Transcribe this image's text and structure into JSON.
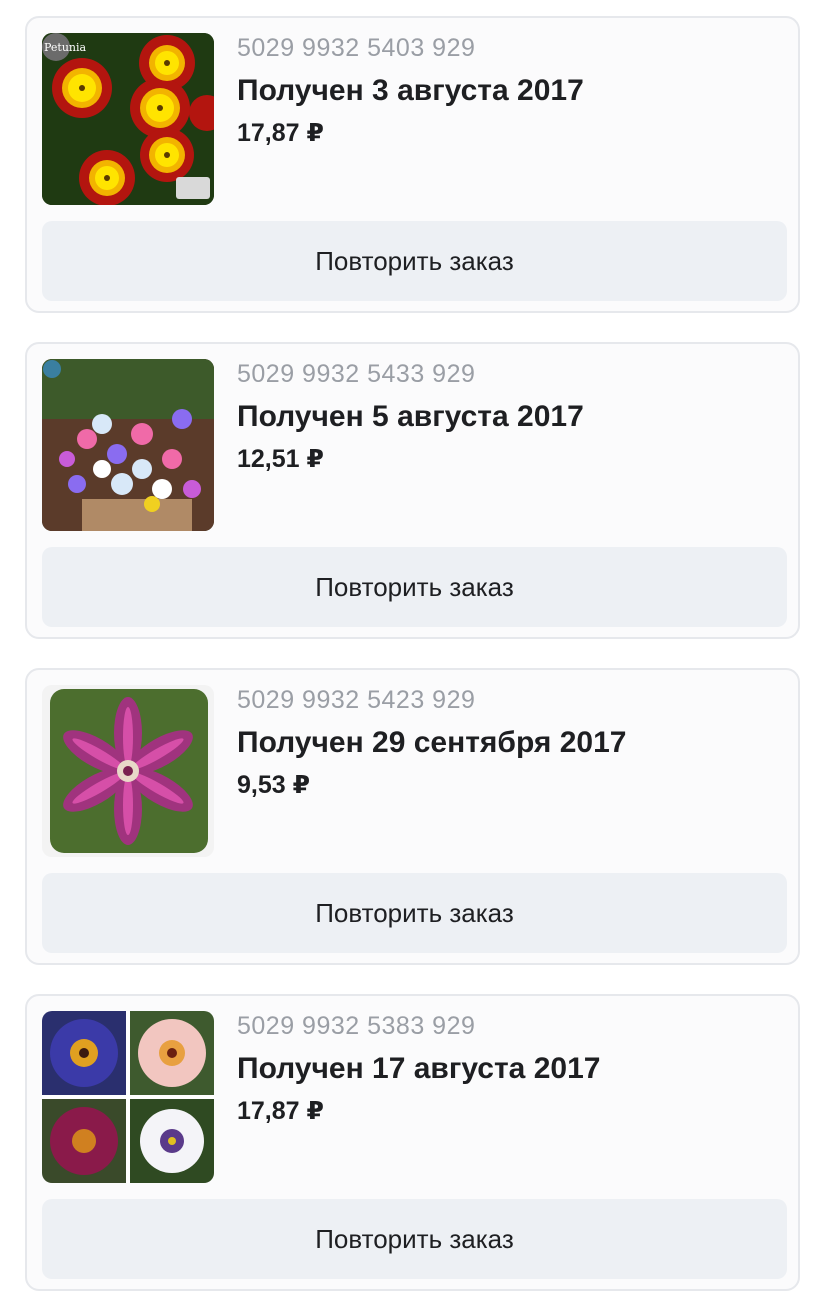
{
  "orders": [
    {
      "number": "5029 9932 5403 929",
      "status": "Получен 3 августа 2017",
      "price": "17,87 ₽",
      "button_label": "Повторить заказ",
      "image_icon": "primula-flowers-image",
      "image_badge": "Petunia"
    },
    {
      "number": "5029 9932 5433 929",
      "status": "Получен 5 августа 2017",
      "price": "12,51 ₽",
      "button_label": "Повторить заказ",
      "image_icon": "clematis-flowerpot-image"
    },
    {
      "number": "5029 9932 5423 929",
      "status": "Получен 29 сентября 2017",
      "price": "9,53 ₽",
      "button_label": "Повторить заказ",
      "image_icon": "purple-clematis-image"
    },
    {
      "number": "5029 9932 5383 929",
      "status": "Получен 17 августа 2017",
      "price": "17,87 ₽",
      "button_label": "Повторить заказ",
      "image_icon": "salpiglossis-collage-image"
    }
  ],
  "colors": {
    "card_border": "#e6e8ec",
    "button_background": "#edf0f4",
    "muted_text": "#9a9ea5",
    "primary_text": "#1e1f22"
  }
}
